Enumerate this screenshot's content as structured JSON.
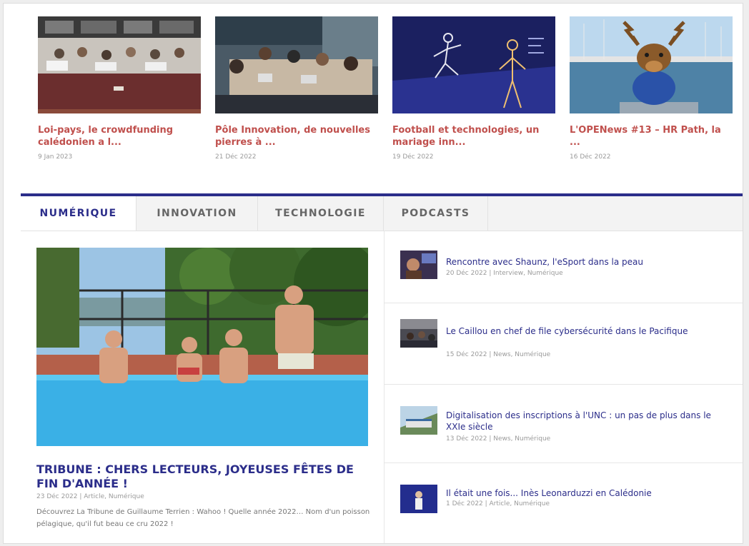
{
  "top_articles": [
    {
      "title": "Loi-pays, le crowdfunding calédonien a l...",
      "date": "9 Jan 2023",
      "image": "council-chamber-photo"
    },
    {
      "title": "Pôle Innovation, de nouvelles pierres à ...",
      "date": "21 Déc 2022",
      "image": "meeting-room-photo"
    },
    {
      "title": "Football et technologies, un mariage inn...",
      "date": "19 Déc 2022",
      "image": "motion-capture-photo"
    },
    {
      "title": "L'OPENews #13 – HR Path, la ...",
      "date": "16 Déc 2022",
      "image": "moose-mascot-harbor-photo"
    }
  ],
  "tabs": [
    {
      "label": "NUMÉRIQUE",
      "active": true
    },
    {
      "label": "INNOVATION",
      "active": false
    },
    {
      "label": "TECHNOLOGIE",
      "active": false
    },
    {
      "label": "PODCASTS",
      "active": false
    }
  ],
  "featured": {
    "title": "TRIBUNE : CHERS LECTEURS, JOYEUSES FÊTES DE FIN D'ANNÉE !",
    "meta": "23 Déc 2022 | Article, Numérique",
    "excerpt": "Découvrez La Tribune de Guillaume Terrien : Wahoo ! Quelle année 2022… Nom d'un poisson pélagique, qu'il fut beau ce cru 2022 !",
    "image": "friends-in-pool-photo"
  },
  "side_articles": [
    {
      "title": "Rencontre avec Shaunz, l'eSport dans la peau",
      "meta": "20 Déc 2022 | Interview, Numérique"
    },
    {
      "title": "Le Caillou en chef de file cybersécurité dans le Pacifique",
      "meta": "15 Déc 2022 | News, Numérique"
    },
    {
      "title": "Digitalisation des inscriptions à l'UNC : un pas de plus dans le XXIe siècle",
      "meta": "13 Déc 2022 | News, Numérique"
    },
    {
      "title": "Il était une fois... Inès Leonarduzzi en Calédonie",
      "meta": "1 Déc 2022 | Article, Numérique"
    }
  ],
  "colors": {
    "accent": "#2b2d8a",
    "headline_red": "#c0504d",
    "meta_gray": "#9a9a9a"
  }
}
